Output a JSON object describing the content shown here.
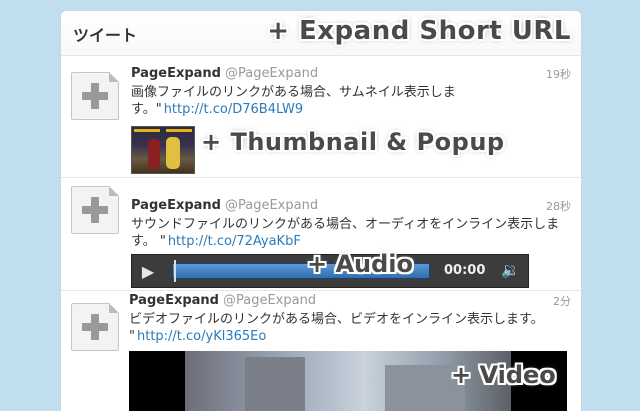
{
  "header": {
    "title": "ツイート",
    "promo": "+ Expand Short URL"
  },
  "tweets": [
    {
      "author": "PageExpand",
      "handle": "@PageExpand",
      "time": "19秒",
      "text": "画像ファイルのリンクがある場合、サムネイル表示します。\"",
      "link": "http://t.co/D76B4LW9",
      "promo": "+ Thumbnail & Popup"
    },
    {
      "author": "PageExpand",
      "handle": "@PageExpand",
      "time": "28秒",
      "text": "サウンドファイルのリンクがある場合、オーディオをインライン表示します。 \"",
      "link": "http://t.co/72AyaKbF",
      "audio_time": "00:00",
      "promo": "+ Audio"
    },
    {
      "author": "PageExpand",
      "handle": "@PageExpand",
      "time": "2分",
      "text": "ビデオファイルのリンクがある場合、ビデオをインライン表示します。 \"",
      "link": "http://t.co/yKl365Eo",
      "promo": "+ Video"
    }
  ],
  "icons": {
    "avatar": "plus-avatar-icon",
    "play": "play-icon",
    "volume": "volume-icon"
  },
  "colors": {
    "background": "#c0deed",
    "link": "#2b7bb9",
    "audio_track": "#3f82c6"
  }
}
